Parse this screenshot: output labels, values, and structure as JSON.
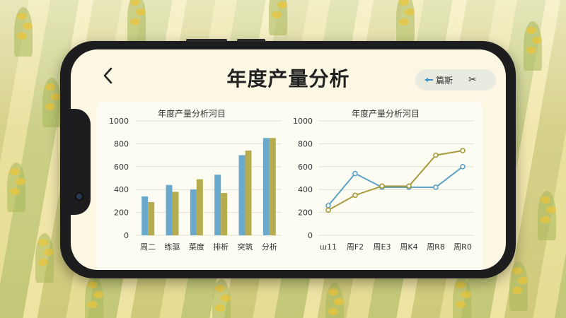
{
  "header": {
    "title": "年度产量分析",
    "filter_label": "篇斯",
    "share_label": "✂"
  },
  "colors": {
    "blue": "#6aa8cc",
    "olive": "#b5ac4f",
    "line_blue": "#5ca3c7",
    "line_olive": "#a79a3a"
  },
  "chart_data": [
    {
      "type": "bar",
      "title": "年度产量分析河目",
      "categories": [
        "周二",
        "练驱",
        "菜度",
        "排析",
        "突筑",
        "分析"
      ],
      "ylim": [
        0,
        1000
      ],
      "yticks": [
        "0",
        "200",
        "400",
        "600",
        "800",
        "1000"
      ],
      "series": [
        {
          "values": [
            340,
            440,
            400,
            530,
            700,
            850
          ]
        },
        {
          "values": [
            290,
            380,
            490,
            370,
            740,
            850
          ]
        }
      ],
      "grid": true
    },
    {
      "type": "line",
      "title": "年度产量分析河目",
      "categories": [
        "ш11",
        "周F2",
        "周E3",
        "周K4",
        "周R8",
        "周R0"
      ],
      "ylim": [
        0,
        1000
      ],
      "yticks": [
        "0",
        "200",
        "400",
        "600",
        "800",
        "1000"
      ],
      "series": [
        {
          "values": [
            260,
            540,
            420,
            420,
            420,
            600
          ]
        },
        {
          "values": [
            220,
            350,
            430,
            430,
            700,
            740
          ]
        }
      ],
      "grid": true
    }
  ]
}
